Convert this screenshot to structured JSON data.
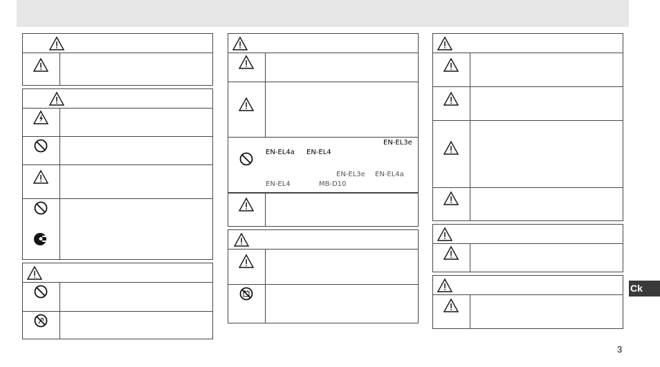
{
  "page": {
    "number": "3",
    "language_tab": "Ck"
  },
  "battery": {
    "line1": "EN-EL3e",
    "line2_a": "EN-EL4a",
    "line2_b": "EN-EL4",
    "line3_a": "EN-EL3e",
    "line3_b": "EN-EL4a",
    "line4_a": "EN-EL4",
    "line4_b": "MB-D10"
  },
  "icons": {
    "warning": "warning-triangle-icon",
    "electric": "electric-shock-warning-icon",
    "prohibited": "prohibited-icon",
    "disassemble": "do-not-disassemble-icon",
    "unplug": "unplug-icon",
    "no_water": "no-water-icon"
  }
}
